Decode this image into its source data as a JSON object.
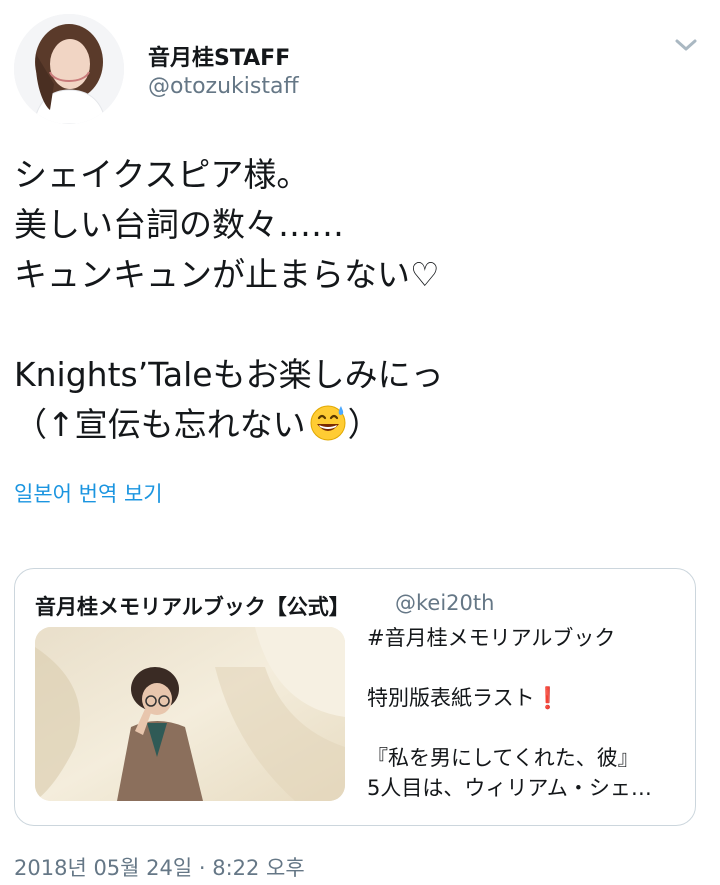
{
  "author": {
    "name": "音月桂STAFF",
    "handle": "@otozukistaff"
  },
  "tweet": {
    "lines": [
      "シェイクスピア様。",
      "美しい台詞の数々……",
      "キュンキュンが止まらない♡",
      "",
      "Knights’Taleもお楽しみにっ",
      "（↑宣伝も忘れない"
    ],
    "line6_close": "）",
    "emoji": "grinning-sweat-emoji"
  },
  "translate_label": "일본어 번역 보기",
  "quote": {
    "name": "音月桂メモリアルブック【公式】",
    "handle": "@kei20th",
    "text_lines": [
      "#音月桂メモリアルブック",
      "",
      "特別版表紙ラスト",
      "",
      "『私を男にしてくれた、彼』",
      "5人目は、ウィリアム・シェ…"
    ],
    "exclaim": "❗"
  },
  "timestamp": "2018년 05월 24일 · 8:22 오후",
  "colors": {
    "link": "#1b95e0",
    "secondary_text": "#657786",
    "border": "#ccd6dd"
  }
}
